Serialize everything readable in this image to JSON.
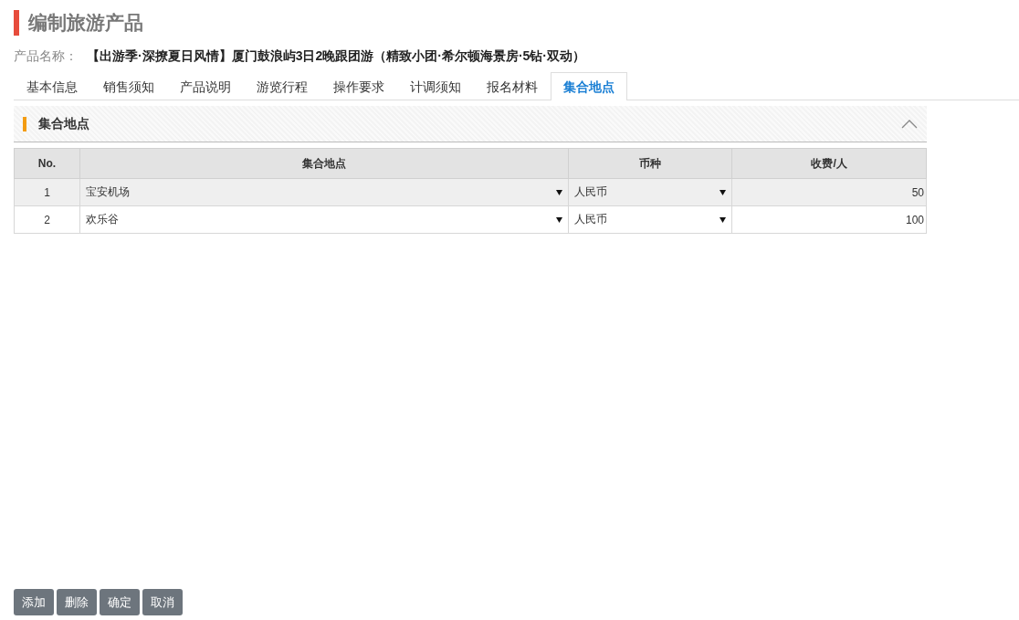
{
  "page_title": "编制旅游产品",
  "product": {
    "label": "产品名称：",
    "name": "【出游季·深撩夏日风情】厦门鼓浪屿3日2晚跟团游（精致小团·希尔顿海景房·5钻·双动）"
  },
  "tabs": [
    {
      "label": "基本信息",
      "selected": false
    },
    {
      "label": "销售须知",
      "selected": false
    },
    {
      "label": "产品说明",
      "selected": false
    },
    {
      "label": "游览行程",
      "selected": false
    },
    {
      "label": "操作要求",
      "selected": false
    },
    {
      "label": "计调须知",
      "selected": false
    },
    {
      "label": "报名材料",
      "selected": false
    },
    {
      "label": "集合地点",
      "selected": true
    }
  ],
  "section": {
    "title": "集合地点",
    "expanded": true
  },
  "table": {
    "columns": [
      "No.",
      "集合地点",
      "币种",
      "收费/人"
    ],
    "rows": [
      {
        "no": "1",
        "location": "宝安机场",
        "currency": "人民币",
        "fee": "50",
        "selected": true
      },
      {
        "no": "2",
        "location": "欢乐谷",
        "currency": "人民币",
        "fee": "100",
        "selected": false
      }
    ]
  },
  "buttons": [
    "添加",
    "删除",
    "确定",
    "取消"
  ]
}
